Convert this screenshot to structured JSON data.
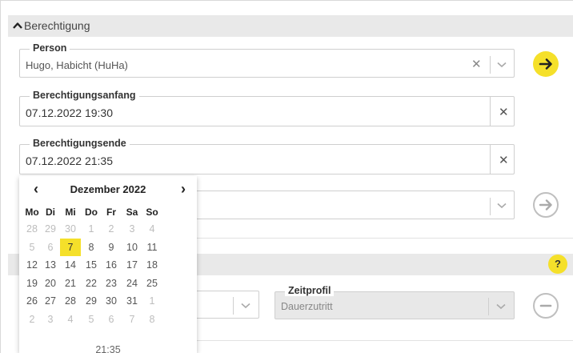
{
  "section": {
    "title": "Berechtigung"
  },
  "person": {
    "legend": "Person",
    "value": "Hugo, Habicht (HuHa)"
  },
  "start": {
    "legend": "Berechtigungsanfang",
    "value": "07.12.2022 19:30"
  },
  "end": {
    "legend": "Berechtigungsende",
    "value": "07.12.2022 21:35"
  },
  "zeitprofil": {
    "legend": "Zeitprofil",
    "value": "Dauerzutritt"
  },
  "help": {
    "label": "?"
  },
  "calendar": {
    "prev": "‹",
    "next": "›",
    "title": "Dezember 2022",
    "weekdays": [
      "Mo",
      "Di",
      "Mi",
      "Do",
      "Fr",
      "Sa",
      "So"
    ],
    "weeks": [
      [
        "28",
        "29",
        "30",
        "1",
        "2",
        "3",
        "4"
      ],
      [
        "5",
        "6",
        "7",
        "8",
        "9",
        "10",
        "11"
      ],
      [
        "12",
        "13",
        "14",
        "15",
        "16",
        "17",
        "18"
      ],
      [
        "19",
        "20",
        "21",
        "22",
        "23",
        "24",
        "25"
      ],
      [
        "26",
        "27",
        "28",
        "29",
        "30",
        "31",
        "1"
      ],
      [
        "2",
        "3",
        "4",
        "5",
        "6",
        "7",
        "8"
      ]
    ],
    "muted": [
      [
        true,
        true,
        true,
        true,
        true,
        true,
        true
      ],
      [
        true,
        true,
        false,
        false,
        false,
        false,
        false
      ],
      [
        false,
        false,
        false,
        false,
        false,
        false,
        false
      ],
      [
        false,
        false,
        false,
        false,
        false,
        false,
        false
      ],
      [
        false,
        false,
        false,
        false,
        false,
        false,
        true
      ],
      [
        true,
        true,
        true,
        true,
        true,
        true,
        true
      ]
    ],
    "selected_day": "7",
    "time": "21:35"
  },
  "colors": {
    "accent": "#f5e02a",
    "band": "#e9e9e9",
    "border": "#cfcfcf"
  }
}
